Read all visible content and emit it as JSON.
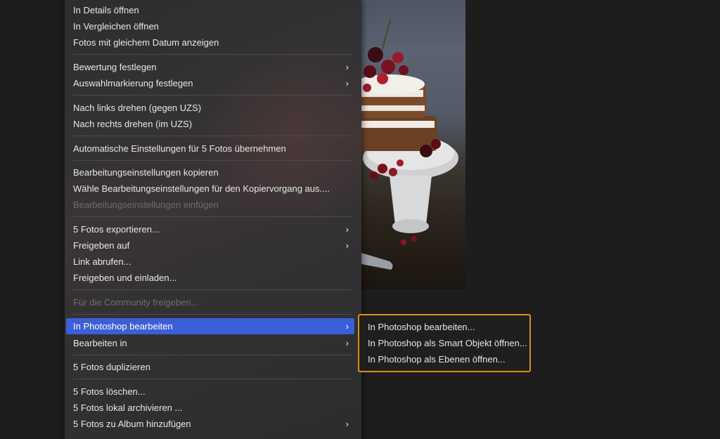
{
  "menu": {
    "items": [
      {
        "label": "In Details öffnen",
        "chevron": false,
        "disabled": false,
        "active": false
      },
      {
        "label": "In Vergleichen öffnen",
        "chevron": false,
        "disabled": false,
        "active": false
      },
      {
        "label": "Fotos mit gleichem Datum anzeigen",
        "chevron": false,
        "disabled": false,
        "active": false
      },
      {
        "label": "Bewertung festlegen",
        "chevron": true,
        "disabled": false,
        "active": false
      },
      {
        "label": "Auswahlmarkierung festlegen",
        "chevron": true,
        "disabled": false,
        "active": false
      },
      {
        "label": "Nach links drehen (gegen UZS)",
        "chevron": false,
        "disabled": false,
        "active": false
      },
      {
        "label": "Nach rechts drehen (im UZS)",
        "chevron": false,
        "disabled": false,
        "active": false
      },
      {
        "label": "Automatische Einstellungen für 5 Fotos übernehmen",
        "chevron": false,
        "disabled": false,
        "active": false
      },
      {
        "label": "Bearbeitungseinstellungen kopieren",
        "chevron": false,
        "disabled": false,
        "active": false
      },
      {
        "label": "Wähle Bearbeitungseinstellungen für den Kopiervorgang aus....",
        "chevron": false,
        "disabled": false,
        "active": false
      },
      {
        "label": "Bearbeitungseinstellungen einfügen",
        "chevron": false,
        "disabled": true,
        "active": false
      },
      {
        "label": "5 Fotos exportieren...",
        "chevron": true,
        "disabled": false,
        "active": false
      },
      {
        "label": "Freigeben auf",
        "chevron": true,
        "disabled": false,
        "active": false
      },
      {
        "label": "Link abrufen...",
        "chevron": false,
        "disabled": false,
        "active": false
      },
      {
        "label": "Freigeben und einladen...",
        "chevron": false,
        "disabled": false,
        "active": false
      },
      {
        "label": "Für die Community freigeben...",
        "chevron": false,
        "disabled": true,
        "active": false
      },
      {
        "label": "In Photoshop bearbeiten",
        "chevron": true,
        "disabled": false,
        "active": true
      },
      {
        "label": "Bearbeiten in",
        "chevron": true,
        "disabled": false,
        "active": false
      },
      {
        "label": "5 Fotos duplizieren",
        "chevron": false,
        "disabled": false,
        "active": false
      },
      {
        "label": "5 Fotos löschen...",
        "chevron": false,
        "disabled": false,
        "active": false
      },
      {
        "label": "5 Fotos lokal archivieren ...",
        "chevron": false,
        "disabled": false,
        "active": false
      },
      {
        "label": "5 Fotos zu Album hinzufügen",
        "chevron": true,
        "disabled": false,
        "active": false
      }
    ],
    "chevron_glyph": "›"
  },
  "submenu": {
    "items": [
      {
        "label": "In Photoshop bearbeiten..."
      },
      {
        "label": "In Photoshop als Smart Objekt öffnen..."
      },
      {
        "label": "In Photoshop als Ebenen öffnen..."
      }
    ],
    "highlight_color": "#d98f19"
  },
  "colors": {
    "active_item": "#3b5fd8",
    "menu_text": "#e8e8e8",
    "disabled_text": "#6c6c6e"
  }
}
